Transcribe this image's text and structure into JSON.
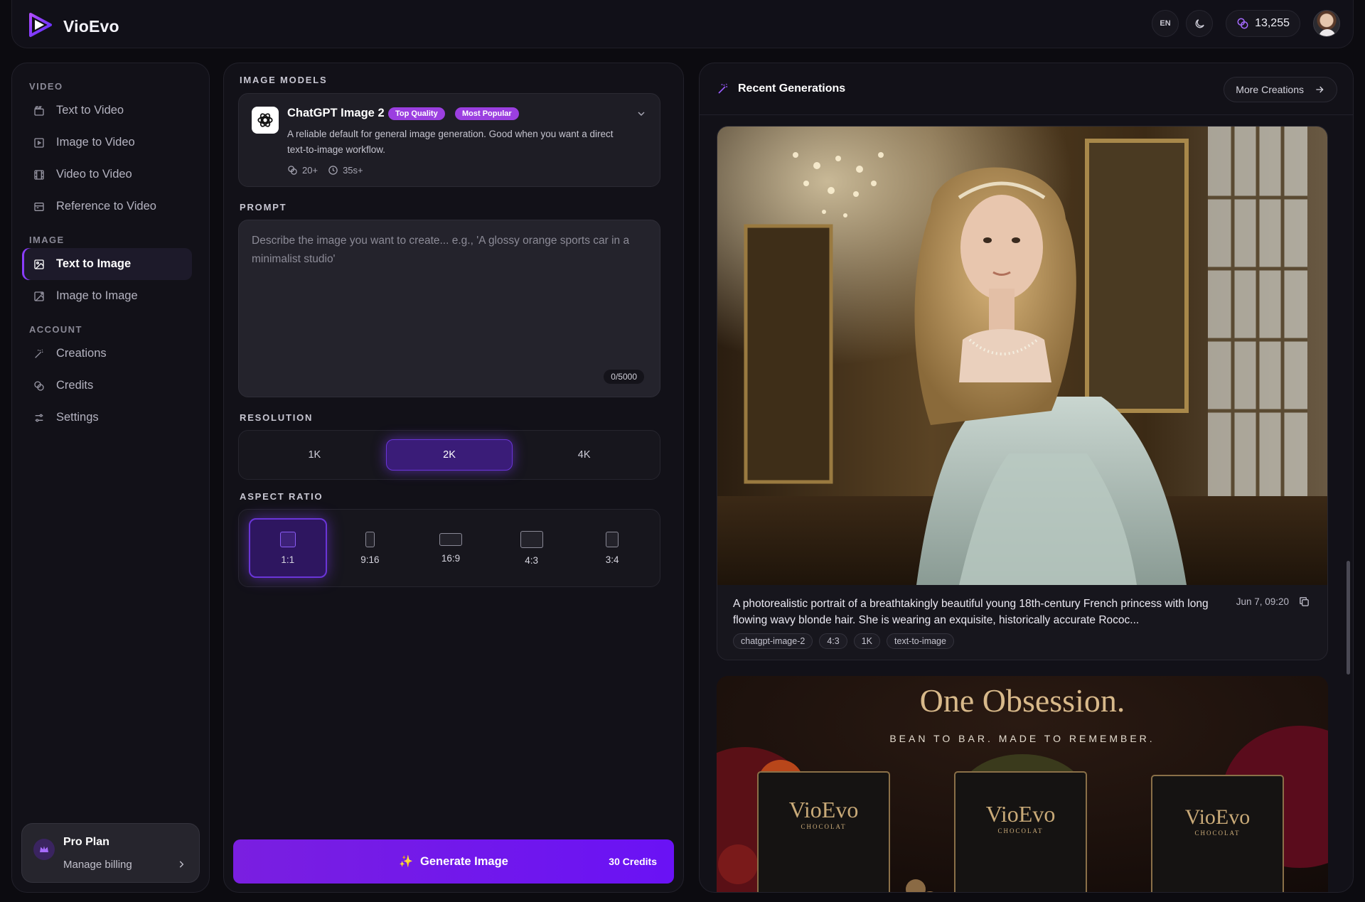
{
  "app": {
    "name": "VioEvo",
    "language": "EN",
    "credits": "13,255",
    "accent": "#8b3dff"
  },
  "sidebar": {
    "sections": [
      {
        "label": "VIDEO",
        "items": [
          {
            "label": "Text to Video",
            "icon": "clapper-icon"
          },
          {
            "label": "Image to Video",
            "icon": "image-play-icon"
          },
          {
            "label": "Video to Video",
            "icon": "film-icon"
          },
          {
            "label": "Reference to Video",
            "icon": "reference-video-icon"
          }
        ]
      },
      {
        "label": "IMAGE",
        "items": [
          {
            "label": "Text to Image",
            "icon": "image-icon",
            "active": true
          },
          {
            "label": "Image to Image",
            "icon": "image-plus-icon"
          }
        ]
      },
      {
        "label": "ACCOUNT",
        "items": [
          {
            "label": "Creations",
            "icon": "wand-icon"
          },
          {
            "label": "Credits",
            "icon": "coins-icon"
          },
          {
            "label": "Settings",
            "icon": "sliders-icon"
          }
        ]
      }
    ],
    "plan": {
      "title": "Pro Plan",
      "subtitle": "Manage billing"
    }
  },
  "generator": {
    "models_label": "IMAGE MODELS",
    "model": {
      "name": "ChatGPT Image 2",
      "badges": [
        "Top Quality",
        "Most Popular"
      ],
      "description": "A reliable default for general image generation. Good when you want a direct text-to-image workflow.",
      "cost": "20+",
      "time": "35s+"
    },
    "prompt_label": "PROMPT",
    "prompt_placeholder": "Describe the image you want to create... e.g., 'A glossy orange sports car in a minimalist studio'",
    "prompt_value": "",
    "char_count": "0/5000",
    "resolution_label": "RESOLUTION",
    "resolutions": [
      "1K",
      "2K",
      "4K"
    ],
    "resolution_selected": "2K",
    "aspect_label": "ASPECT RATIO",
    "aspects": [
      "1:1",
      "9:16",
      "16:9",
      "4:3",
      "3:4"
    ],
    "aspect_selected": "1:1",
    "generate_label": "Generate Image",
    "generate_cost": "30 Credits"
  },
  "recent": {
    "title": "Recent Generations",
    "more_label": "More Creations",
    "items": [
      {
        "caption": "A photorealistic portrait of a breathtakingly beautiful young 18th-century French princess with long flowing wavy blonde hair. She is wearing an exquisite, historically accurate Rococ...",
        "date": "Jun 7, 09:20",
        "tags": [
          "chatgpt-image-2",
          "4:3",
          "1K",
          "text-to-image"
        ]
      },
      {
        "headline": "One Obsession.",
        "tagline": "BEAN TO BAR. MADE TO REMEMBER.",
        "bars": [
          {
            "brand": "VioEvo",
            "sub": "CHOCOLAT"
          },
          {
            "brand": "VioEvo",
            "sub": "CHOCOLAT"
          },
          {
            "brand": "VioEvo",
            "sub": "CHOCOLAT"
          }
        ]
      }
    ]
  }
}
